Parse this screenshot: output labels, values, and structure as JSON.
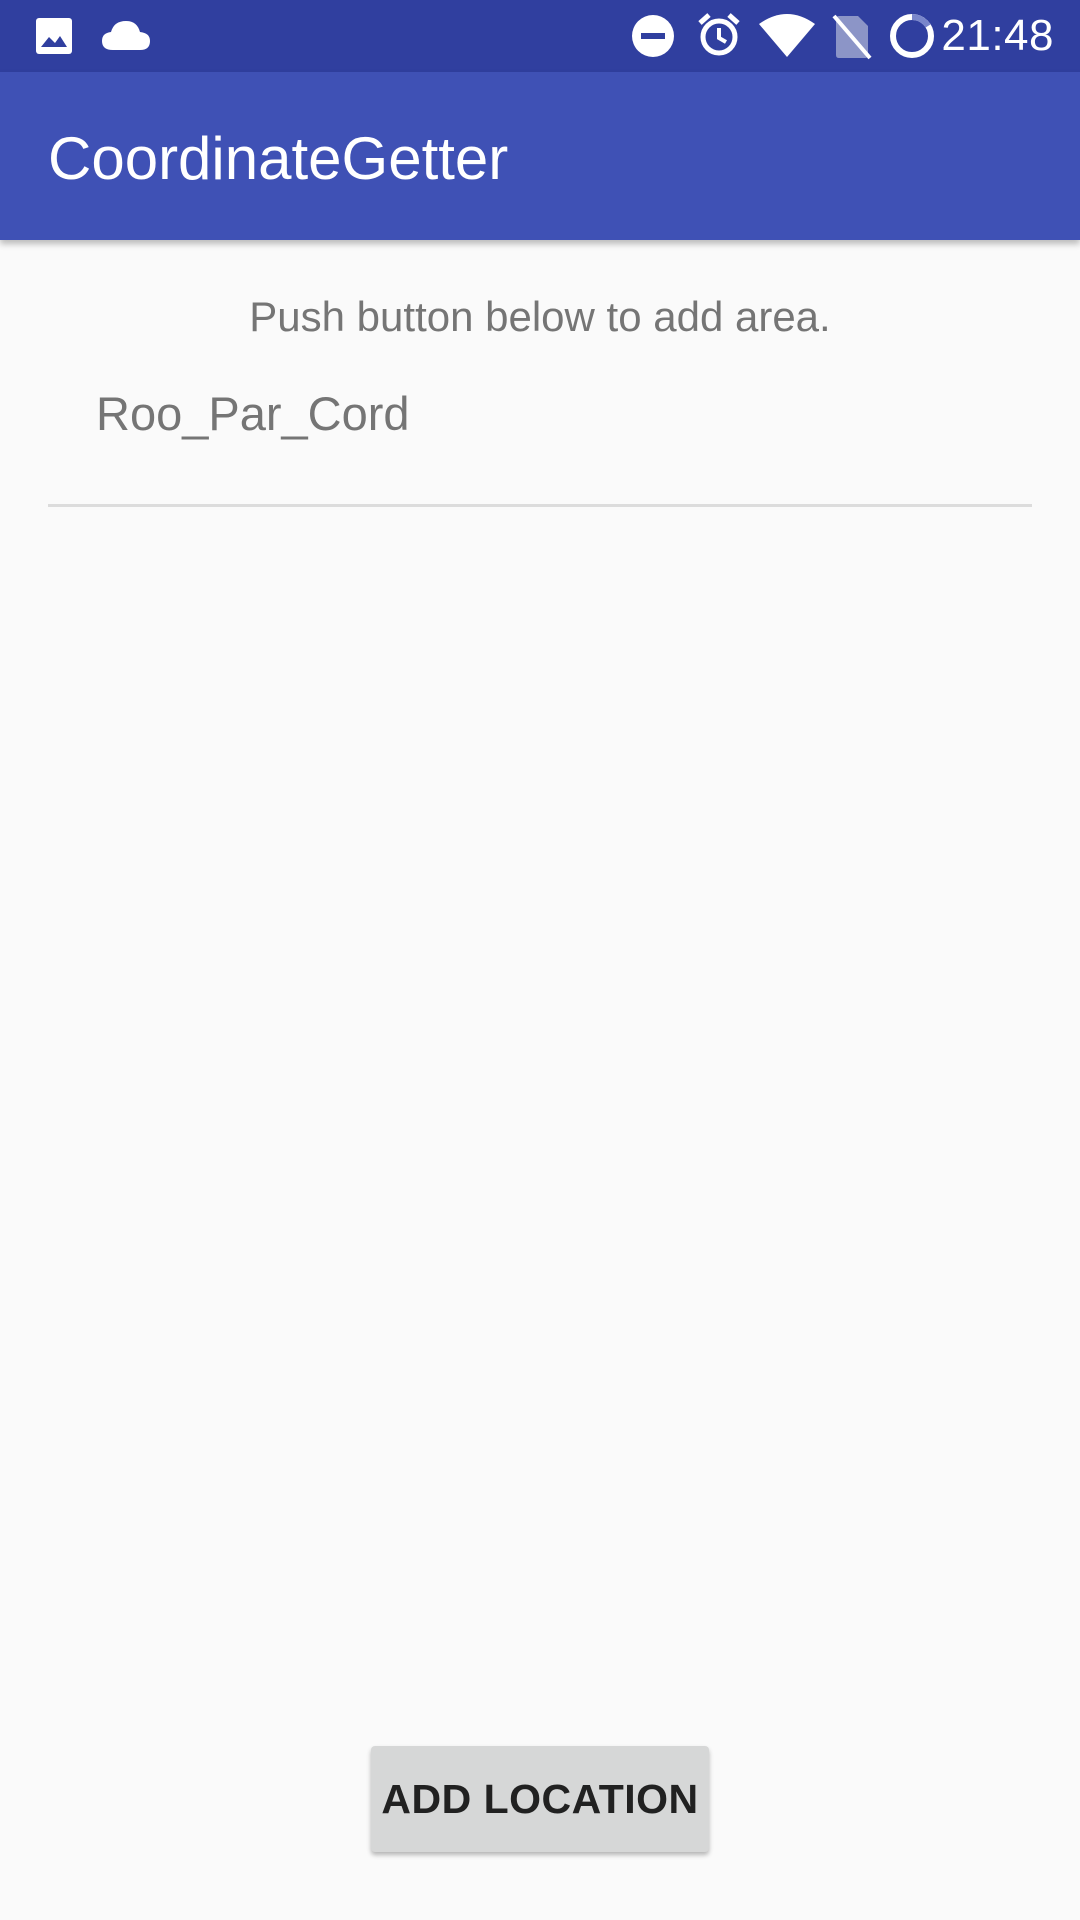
{
  "status_bar": {
    "time": "21:48",
    "icons": [
      "image-icon",
      "cloud-icon",
      "do-not-disturb-icon",
      "alarm-icon",
      "wifi-icon",
      "no-sim-icon",
      "battery-icon"
    ]
  },
  "app_bar": {
    "title": "CoordinateGetter"
  },
  "main": {
    "instruction": "Push button below to add area.",
    "items": [
      {
        "label": "Roo_Par_Cord"
      }
    ]
  },
  "footer": {
    "add_button_label": "ADD LOCATION"
  },
  "colors": {
    "status_bar": "#303f9f",
    "app_bar": "#3f51b5",
    "background": "#fafafa",
    "secondary_text": "#757575",
    "button": "#d6d7d7"
  }
}
